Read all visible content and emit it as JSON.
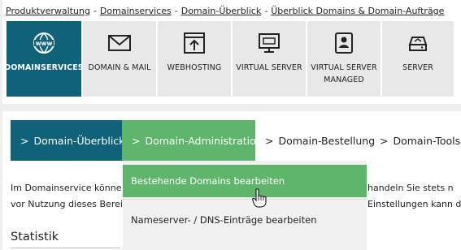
{
  "breadcrumb": [
    "Produktverwaltung",
    "Domainservices",
    "Domain-Überblick",
    "Überblick Domains & Domain-Aufträge"
  ],
  "breadcrumb_separator": "-",
  "tiles": [
    {
      "label": "DOMAINSERVICES",
      "icon": "www-globe-icon"
    },
    {
      "label": "DOMAIN & MAIL",
      "icon": "envelope-icon"
    },
    {
      "label": "WEBHOSTING",
      "icon": "upload-window-icon"
    },
    {
      "label": "VIRTUAL SERVER",
      "icon": "monitor-icon"
    },
    {
      "label": "VIRTUAL SERVER MANAGED",
      "icon": "managed-server-icon"
    },
    {
      "label": "SERVER",
      "icon": "server-icon"
    }
  ],
  "tabs": [
    {
      "label": "Domain-Überblick",
      "chevron": ">"
    },
    {
      "label": "Domain-Administration",
      "chevron": ">"
    },
    {
      "label": "Domain-Bestellung",
      "chevron": ">"
    },
    {
      "label": "Domain-Tools",
      "chevron": ">"
    }
  ],
  "body_text": {
    "line1_left": "Im Domainservice könne",
    "line2_left": "vor Nutzung dieses Berei",
    "line1_right": "handeln Sie stets n",
    "line2_right": "Einstellungen kann d"
  },
  "section_title": "Statistik",
  "dropdown": {
    "items": [
      "Bestehende Domains bearbeiten",
      "Nameserver- / DNS-Einträge bearbeiten"
    ]
  },
  "colors": {
    "dark_teal": "#0f6277",
    "green": "#5fb56b",
    "tile_bg": "#e8e8e8"
  }
}
